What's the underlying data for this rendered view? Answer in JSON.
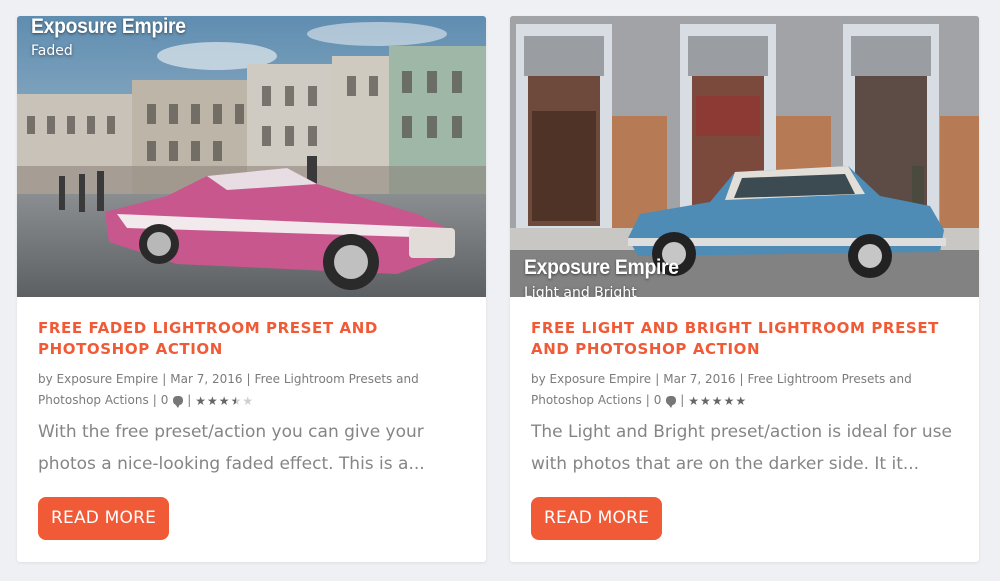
{
  "posts": [
    {
      "watermark_brand": "Exposure Empire",
      "watermark_sub": "Faded",
      "title": "FREE FADED LIGHTROOM PRESET AND PHOTOSHOP ACTION",
      "meta": {
        "by": "by Exposure Empire",
        "date": "Mar 7, 2016",
        "category": "Free Lightroom Presets and Photoshop Actions",
        "comments": "0",
        "rating": 3.5
      },
      "excerpt": "With the free preset/action you can give your photos a nice-looking faded effect. This is a...",
      "read_more": "READ MORE"
    },
    {
      "watermark_brand": "Exposure Empire",
      "watermark_sub": "Light and Bright",
      "title": "FREE LIGHT AND BRIGHT LIGHTROOM PRESET AND PHOTOSHOP ACTION",
      "meta": {
        "by": "by Exposure Empire",
        "date": "Mar 7, 2016",
        "category": "Free Lightroom Presets and Photoshop Actions",
        "comments": "0",
        "rating": 5
      },
      "excerpt": "The Light and Bright preset/action is ideal for use with photos that are on the darker side. It it...",
      "read_more": "READ MORE"
    }
  ],
  "colors": {
    "accent": "#f05a36",
    "background": "#eef0f4",
    "text_muted": "#858585"
  },
  "icons": {
    "comment": "comment-icon",
    "star": "star-icon"
  }
}
